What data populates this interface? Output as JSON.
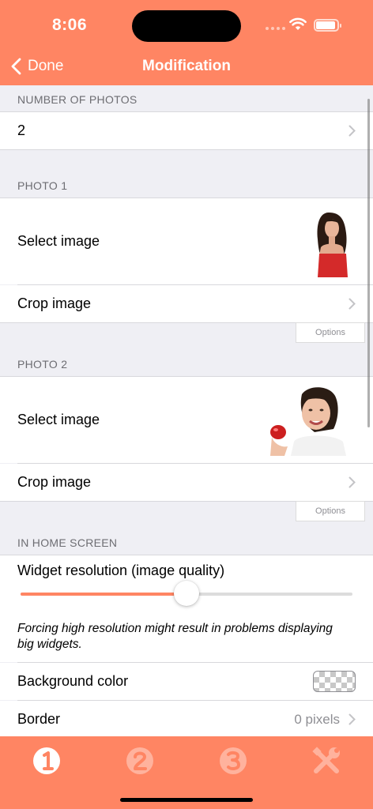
{
  "status": {
    "time": "8:06"
  },
  "nav": {
    "back_label": "Done",
    "title": "Modification"
  },
  "sections": {
    "number_of_photos": {
      "header": "NUMBER OF PHOTOS",
      "value": "2"
    },
    "photo1": {
      "header": "PHOTO 1",
      "select_label": "Select image",
      "crop_label": "Crop image",
      "options_label": "Options"
    },
    "photo2": {
      "header": "PHOTO 2",
      "select_label": "Select image",
      "crop_label": "Crop image",
      "options_label": "Options"
    },
    "home_screen": {
      "header": "IN HOME SCREEN",
      "resolution_label": "Widget resolution (image quality)",
      "resolution_level": 0.5,
      "note": "Forcing high resolution might result in problems displaying big widgets.",
      "background_label": "Background color",
      "border_label": "Border",
      "border_value": "0 pixels"
    }
  },
  "tabs": [
    {
      "icon": "number-1-icon",
      "selected": true
    },
    {
      "icon": "number-2-icon",
      "selected": false
    },
    {
      "icon": "number-3-icon",
      "selected": false
    },
    {
      "icon": "tools-icon",
      "selected": false
    }
  ],
  "colors": {
    "accent": "#ff8563",
    "background": "#efeff4",
    "tab_selected": "#ffffff",
    "tab_unselected": "#ffb29d"
  }
}
